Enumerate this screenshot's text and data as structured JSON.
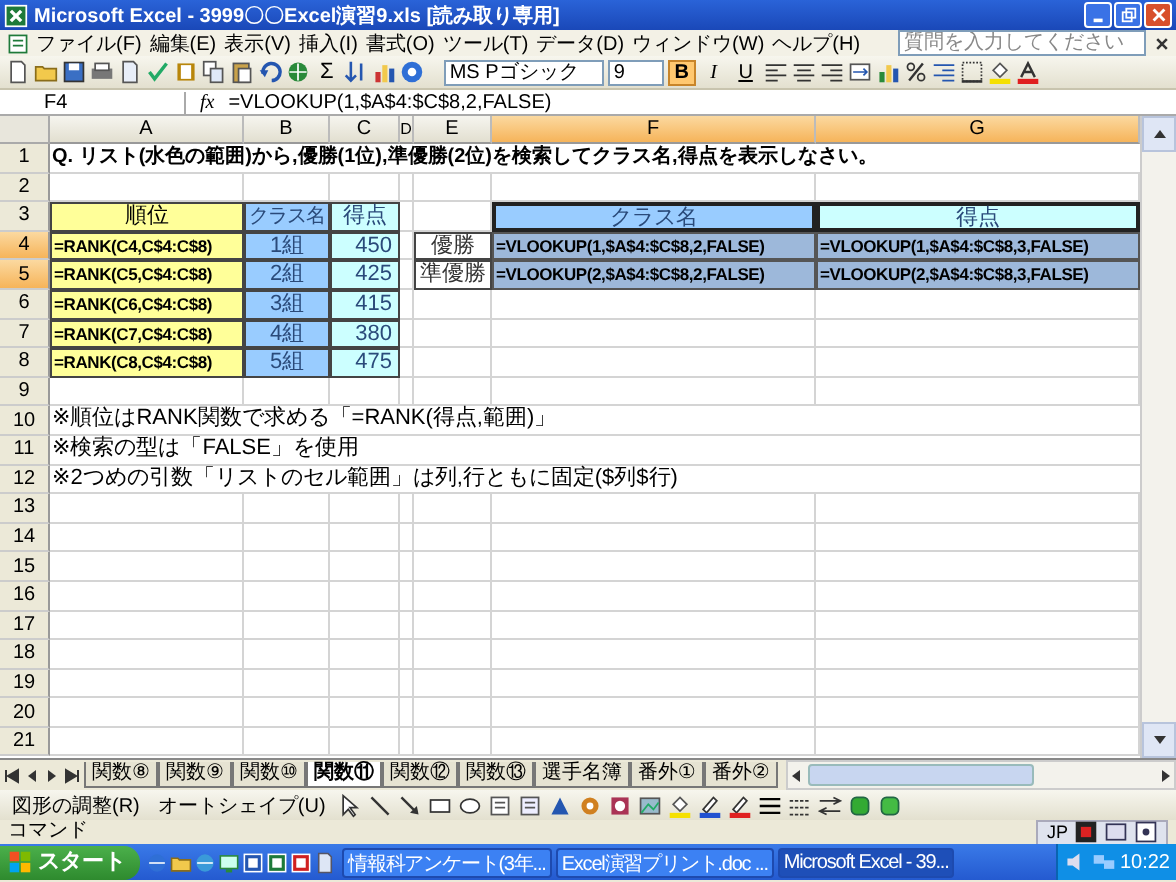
{
  "window": {
    "title": "Microsoft Excel - 3999〇〇Excel演習9.xls [読み取り専用]"
  },
  "menu": [
    "ファイル(F)",
    "編集(E)",
    "表示(V)",
    "挿入(I)",
    "書式(O)",
    "ツール(T)",
    "データ(D)",
    "ウィンドウ(W)",
    "ヘルプ(H)"
  ],
  "help_search": {
    "placeholder": "質問を入力してください"
  },
  "formatting": {
    "autosum": "Σ",
    "font": "MS Pゴシック",
    "size": "9",
    "bold": {
      "label": "B",
      "on": true
    },
    "italic": {
      "label": "I",
      "on": false
    },
    "underline": {
      "label": "U",
      "on": false
    }
  },
  "formula_bar": {
    "name_box": "F4",
    "fx": "fx",
    "formula": "=VLOOKUP(1,$A$4:$C$8,2,FALSE)"
  },
  "columns": [
    {
      "label": "A",
      "selected": false
    },
    {
      "label": "B",
      "selected": false
    },
    {
      "label": "C",
      "selected": false
    },
    {
      "label": "D",
      "selected": false
    },
    {
      "label": "E",
      "selected": false
    },
    {
      "label": "F",
      "selected": true
    },
    {
      "label": "G",
      "selected": true
    }
  ],
  "rows": [
    {
      "number": "1",
      "selected": false,
      "cells": [
        {
          "kind": "question",
          "text": "Q. リスト(水色の範囲)から,優勝(1位),準優勝(2位)を検索してクラス名,得点を表示しなさい。"
        }
      ]
    },
    {
      "number": "2",
      "selected": false
    },
    {
      "number": "3",
      "selected": false,
      "cells": [
        {
          "kind": "header_rank",
          "text": "順位"
        },
        {
          "kind": "header_class",
          "text": "クラス名"
        },
        {
          "kind": "header_score",
          "text": "得点"
        },
        {
          "kind": "result_header_name",
          "text": "クラス名"
        },
        {
          "kind": "result_header_score",
          "text": "得点"
        }
      ]
    },
    {
      "number": "4",
      "selected": true,
      "cells": [
        {
          "kind": "rank",
          "text": "=RANK(C4,C$4:C$8)"
        },
        {
          "kind": "class",
          "text": "1組"
        },
        {
          "kind": "score",
          "text": "450"
        },
        {
          "kind": "label",
          "text": "優勝"
        },
        {
          "kind": "lookup_name",
          "text": "=VLOOKUP(1,$A$4:$C$8,2,FALSE)"
        },
        {
          "kind": "lookup_score",
          "text": "=VLOOKUP(1,$A$4:$C$8,3,FALSE)"
        }
      ]
    },
    {
      "number": "5",
      "selected": true,
      "cells": [
        {
          "kind": "rank",
          "text": "=RANK(C5,C$4:C$8)"
        },
        {
          "kind": "class",
          "text": "2組"
        },
        {
          "kind": "score",
          "text": "425"
        },
        {
          "kind": "label",
          "text": "準優勝"
        },
        {
          "kind": "lookup_name",
          "text": "=VLOOKUP(2,$A$4:$C$8,2,FALSE)"
        },
        {
          "kind": "lookup_score",
          "text": "=VLOOKUP(2,$A$4:$C$8,3,FALSE)"
        }
      ]
    },
    {
      "number": "6",
      "selected": false,
      "cells": [
        {
          "kind": "rank",
          "text": "=RANK(C6,C$4:C$8)"
        },
        {
          "kind": "class",
          "text": "3組"
        },
        {
          "kind": "score",
          "text": "415"
        }
      ]
    },
    {
      "number": "7",
      "selected": false,
      "cells": [
        {
          "kind": "rank",
          "text": "=RANK(C7,C$4:C$8)"
        },
        {
          "kind": "class",
          "text": "4組"
        },
        {
          "kind": "score",
          "text": "380"
        }
      ]
    },
    {
      "number": "8",
      "selected": false,
      "cells": [
        {
          "kind": "rank",
          "text": "=RANK(C8,C$4:C$8)"
        },
        {
          "kind": "class",
          "text": "5組"
        },
        {
          "kind": "score",
          "text": "475"
        }
      ]
    },
    {
      "number": "9",
      "selected": false
    },
    {
      "number": "10",
      "selected": false,
      "cells": [
        {
          "kind": "note",
          "text": "※順位はRANK関数で求める「=RANK(得点,範囲)」"
        }
      ]
    },
    {
      "number": "11",
      "selected": false,
      "cells": [
        {
          "kind": "note",
          "text": "※検索の型は「FALSE」を使用"
        }
      ]
    },
    {
      "number": "12",
      "selected": false,
      "cells": [
        {
          "kind": "note",
          "text": "※2つめの引数「リストのセル範囲」は列,行ともに固定($列$行)"
        }
      ]
    },
    {
      "number": "13",
      "selected": false
    },
    {
      "number": "14",
      "selected": false
    },
    {
      "number": "15",
      "selected": false
    },
    {
      "number": "16",
      "selected": false
    },
    {
      "number": "17",
      "selected": false
    },
    {
      "number": "18",
      "selected": false
    },
    {
      "number": "19",
      "selected": false
    },
    {
      "number": "20",
      "selected": false
    },
    {
      "number": "21",
      "selected": false
    }
  ],
  "sheet_tabs": [
    {
      "label": "関数⑧",
      "selected": false
    },
    {
      "label": "関数⑨",
      "selected": false
    },
    {
      "label": "関数⑩",
      "selected": false
    },
    {
      "label": "関数⑪",
      "selected": true
    },
    {
      "label": "関数⑫",
      "selected": false
    },
    {
      "label": "関数⑬",
      "selected": false
    },
    {
      "label": "選手名簿",
      "selected": false
    },
    {
      "label": "番外①",
      "selected": false
    },
    {
      "label": "番外②",
      "selected": false
    }
  ],
  "drawing_toolbar": {
    "draw_menu": "図形の調整(R)",
    "autoshapes": "オートシェイプ(U)"
  },
  "status_bar": {
    "mode": "コマンド",
    "ime": "JP"
  },
  "taskbar": {
    "start": "スタート",
    "tasks": [
      {
        "label": "情報科アンケート(3年...",
        "selected": false
      },
      {
        "label": "Excel演習プリント.doc ...",
        "selected": false
      },
      {
        "label": "Microsoft Excel - 39...",
        "selected": true
      }
    ],
    "clock": "10:22"
  }
}
